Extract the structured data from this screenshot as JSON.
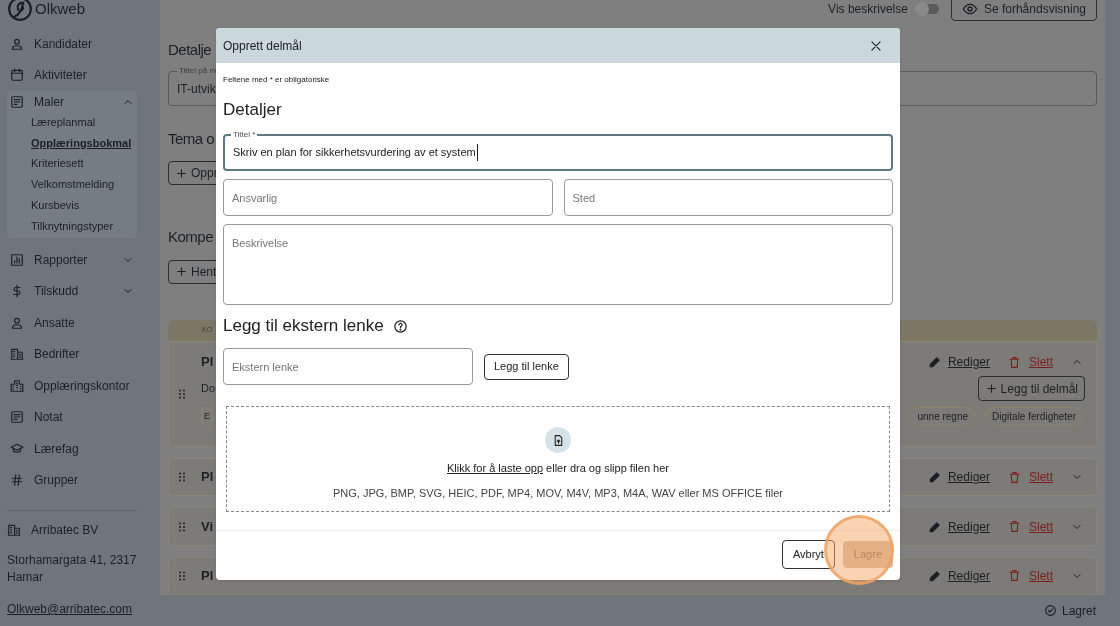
{
  "sidebar": {
    "logo": "Olkweb",
    "items": [
      {
        "label": "Kandidater"
      },
      {
        "label": "Aktiviteter"
      },
      {
        "label": "Maler",
        "expanded": true,
        "children": [
          {
            "label": "Læreplanmal",
            "selected": false
          },
          {
            "label": "Opplæringsbokmal",
            "selected": true
          },
          {
            "label": "Kriteriesett",
            "selected": false
          },
          {
            "label": "Velkomstmelding",
            "selected": false
          },
          {
            "label": "Kursbevis",
            "selected": false
          },
          {
            "label": "Tilknytningstyper",
            "selected": false
          }
        ]
      },
      {
        "label": "Rapporter",
        "expanded": false
      },
      {
        "label": "Tilskudd",
        "expanded": false
      },
      {
        "label": "Ansatte"
      },
      {
        "label": "Bedrifter"
      },
      {
        "label": "Opplæringskontor"
      },
      {
        "label": "Notat"
      },
      {
        "label": "Lærefag"
      },
      {
        "label": "Grupper"
      }
    ],
    "org": {
      "name": "Arribatec BV",
      "address": "Storhamargata 41, 2317 Hamar",
      "email": "Olkweb@arribatec.com"
    }
  },
  "page": {
    "toggle": {
      "label": "Vis beskrivelse",
      "on": false
    },
    "preview_button": "Se forhåndsvisning",
    "details_heading": "Detalje",
    "title_field": {
      "label": "Tittel på m",
      "value": "IT-utvik"
    },
    "theme_heading": "Tema o",
    "create_button": "Oppr",
    "competence_heading": "Kompe",
    "fetch_button": "Hent",
    "table": {
      "column_1": "KO",
      "rows": [
        {
          "title": "Pl",
          "subtitle": "Do",
          "expanded": true,
          "edit": "Rediger",
          "delete": "Slett",
          "add_button": "Legg til delmål",
          "tags": [
            "E",
            "unne regne",
            "Digitale ferdigheter"
          ]
        },
        {
          "title": "Pl",
          "expanded": false,
          "edit": "Rediger",
          "delete": "Slett"
        },
        {
          "title": "Vi",
          "expanded": false,
          "edit": "Rediger",
          "delete": "Slett"
        },
        {
          "title": "Pl",
          "expanded": false,
          "edit": "Rediger",
          "delete": "Slett"
        }
      ]
    }
  },
  "status_bar": {
    "saved": "Lagret"
  },
  "dialog": {
    "title": "Opprett delmål",
    "required_note": "Feltene med * er obligatoriske",
    "details_heading": "Detaljer",
    "title_field": {
      "label": "Tittel *",
      "value": "Skriv en plan for sikkerhetsvurdering av et system"
    },
    "responsible_field": {
      "placeholder": "Ansvarlig"
    },
    "place_field": {
      "placeholder": "Sted"
    },
    "description_field": {
      "placeholder": "Beskrivelse"
    },
    "link_heading": "Legg til ekstern lenke",
    "link_field": {
      "placeholder": "Ekstern lenke"
    },
    "add_link_button": "Legg til lenke",
    "upload": {
      "link": "Klikk for å laste opp",
      "text": "eller dra og slipp filen her",
      "formats": "PNG, JPG, BMP, SVG, HEIC, PDF, MP4, MOV, M4V, MP3, M4A, WAV eller MS OFFICE filer"
    },
    "cancel_button": "Avbryt",
    "save_button": {
      "label": "Lagre",
      "disabled": true
    }
  }
}
